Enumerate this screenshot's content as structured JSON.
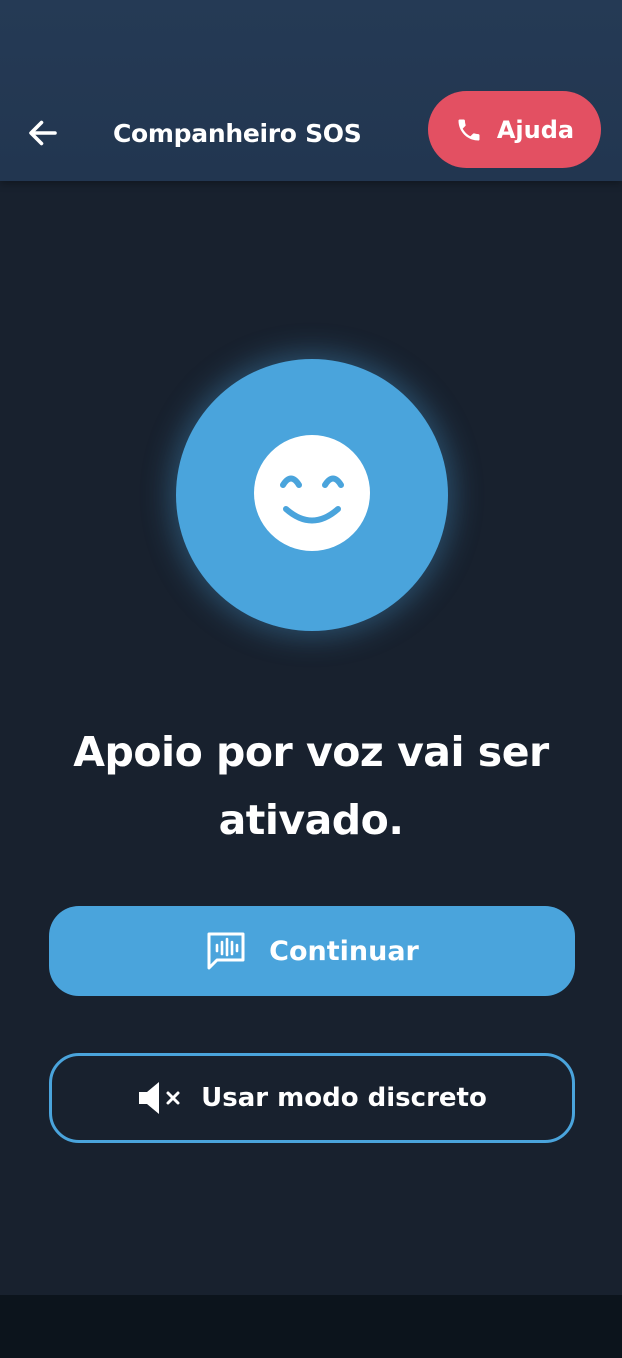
{
  "header": {
    "back_icon": "arrow-left-icon",
    "title": "Companheiro SOS",
    "help_button": {
      "label": "Ajuda",
      "icon": "phone-icon"
    }
  },
  "companion": {
    "icon": "smiling-face-icon"
  },
  "message": "Apoio por voz vai ser ativado.",
  "actions": {
    "continue": {
      "label": "Continuar",
      "icon": "voice-message-icon"
    },
    "discreet": {
      "label": "Usar modo discreto",
      "icon": "speaker-muted-icon"
    }
  },
  "colors": {
    "header_bg": "#253a55",
    "background": "#18212e",
    "accent": "#4aa4dc",
    "danger": "#e35062",
    "text": "#ffffff"
  }
}
